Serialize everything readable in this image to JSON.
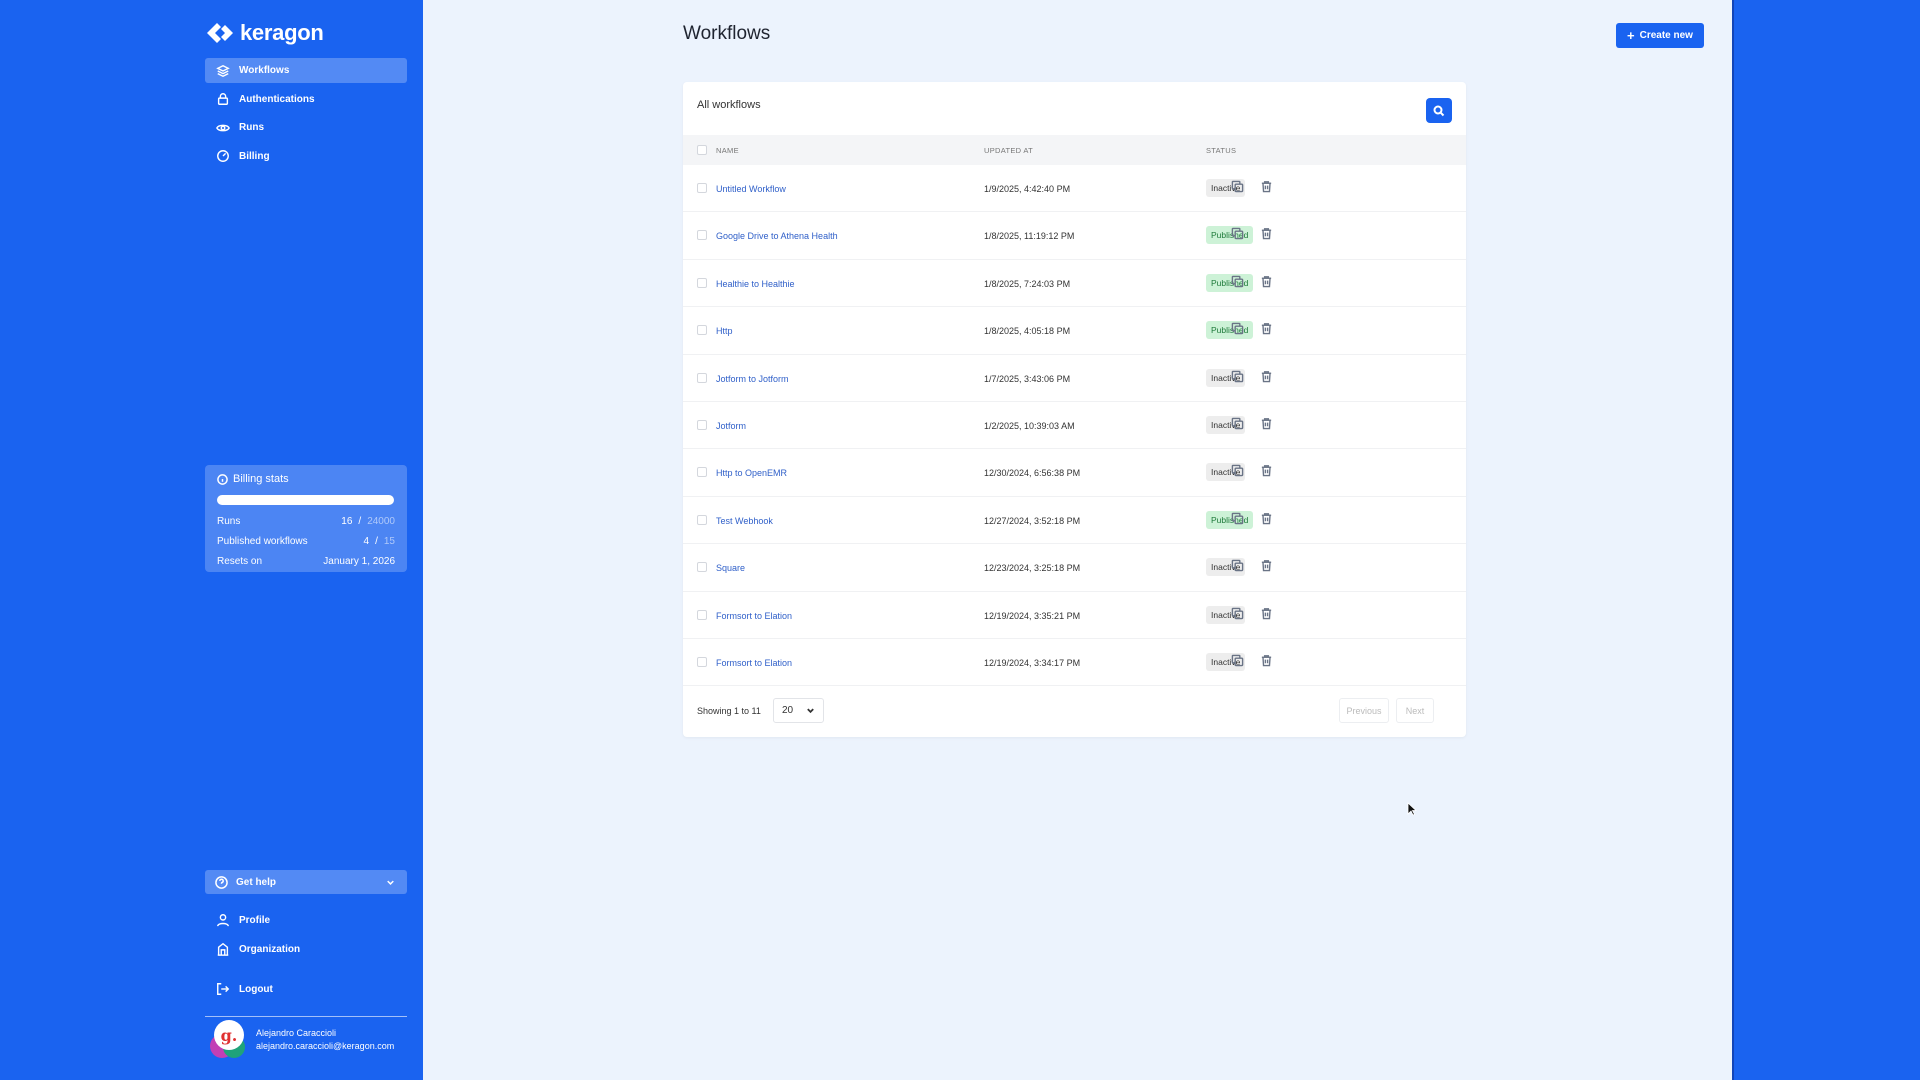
{
  "brand": {
    "name": "keragon"
  },
  "sidebar": {
    "items": [
      {
        "label": "Workflows",
        "icon": "layers-icon",
        "active": true
      },
      {
        "label": "Authentications",
        "icon": "lock-icon",
        "active": false
      },
      {
        "label": "Runs",
        "icon": "eye-icon",
        "active": false
      },
      {
        "label": "Billing",
        "icon": "gauge-icon",
        "active": false
      }
    ],
    "billing_stats": {
      "title": "Billing stats",
      "runs_progress_fraction": 0.0,
      "runs_label": "Runs",
      "runs_used": "16",
      "runs_sep": "/",
      "runs_limit": "24000",
      "published_label": "Published workflows",
      "published_used": "4",
      "published_sep": "/",
      "published_limit": "15",
      "resets_label": "Resets on",
      "resets_value": "January 1, 2026"
    },
    "get_help": "Get help",
    "bottom_items": [
      {
        "label": "Profile",
        "icon": "user-icon"
      },
      {
        "label": "Organization",
        "icon": "building-icon"
      },
      {
        "label": "Logout",
        "icon": "logout-icon"
      }
    ],
    "user": {
      "name": "Alejandro Caraccioli",
      "email": "alejandro.caraccioli@keragon.com",
      "avatar_letter": "g."
    }
  },
  "header": {
    "title": "Workflows",
    "create_label": "Create new"
  },
  "table": {
    "title": "All workflows",
    "columns": {
      "name": "NAME",
      "updated_at": "UPDATED AT",
      "status": "STATUS"
    },
    "rows": [
      {
        "name": "Untitled Workflow",
        "updated_at": "1/9/2025, 4:42:40 PM",
        "status": "Inactive"
      },
      {
        "name": "Google Drive to Athena Health",
        "updated_at": "1/8/2025, 11:19:12 PM",
        "status": "Published"
      },
      {
        "name": "Healthie to Healthie",
        "updated_at": "1/8/2025, 7:24:03 PM",
        "status": "Published"
      },
      {
        "name": "Http",
        "updated_at": "1/8/2025, 4:05:18 PM",
        "status": "Published"
      },
      {
        "name": "Jotform to Jotform",
        "updated_at": "1/7/2025, 3:43:06 PM",
        "status": "Inactive"
      },
      {
        "name": "Jotform",
        "updated_at": "1/2/2025, 10:39:03 AM",
        "status": "Inactive"
      },
      {
        "name": "Http to OpenEMR",
        "updated_at": "12/30/2024, 6:56:38 PM",
        "status": "Inactive"
      },
      {
        "name": "Test Webhook",
        "updated_at": "12/27/2024, 3:52:18 PM",
        "status": "Published"
      },
      {
        "name": "Square",
        "updated_at": "12/23/2024, 3:25:18 PM",
        "status": "Inactive"
      },
      {
        "name": "Formsort to Elation",
        "updated_at": "12/19/2024, 3:35:21 PM",
        "status": "Inactive"
      },
      {
        "name": "Formsort to Elation",
        "updated_at": "12/19/2024, 3:34:17 PM",
        "status": "Inactive"
      }
    ],
    "footer": {
      "showing": "Showing 1 to 11",
      "per_page": "20",
      "previous": "Previous",
      "next": "Next"
    }
  },
  "colors": {
    "brand_blue": "#1a63f0",
    "content_bg": "#ecf3fd",
    "published_bg": "#cdf2d7",
    "published_text": "#1e7a3a",
    "inactive_bg": "#ededed"
  }
}
